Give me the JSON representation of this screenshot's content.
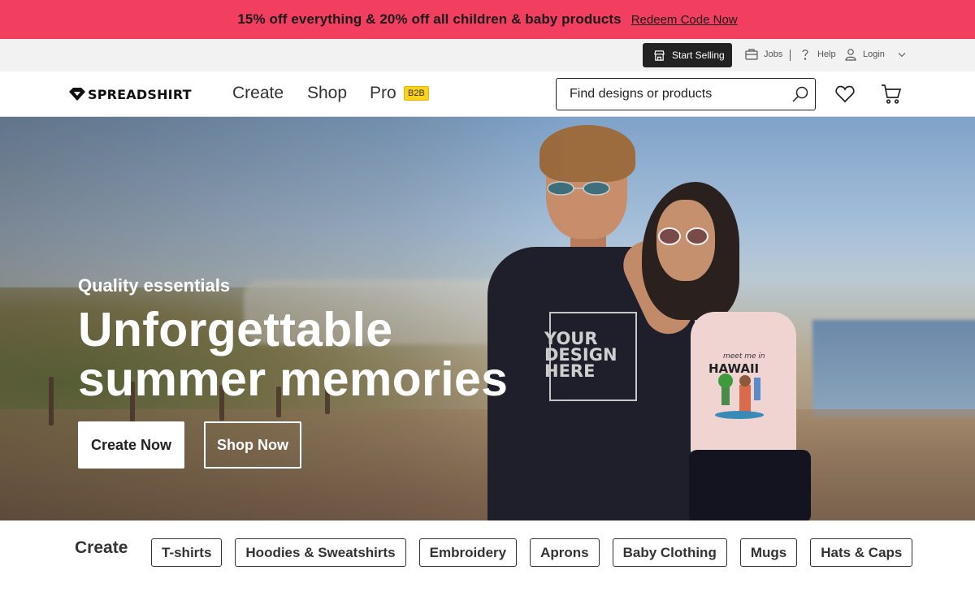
{
  "promo": {
    "text": "15% off everything & 20% off all children & baby products",
    "link": "Redeem Code Now"
  },
  "utility": {
    "start_selling": "Start Selling",
    "jobs": "Jobs",
    "help": "Help",
    "login": "Login"
  },
  "header": {
    "logo": "SPREADSHIRT",
    "nav": [
      "Create",
      "Shop",
      "Pro"
    ],
    "pro_badge": "B2B",
    "search_placeholder": "Find designs or products"
  },
  "hero": {
    "eyebrow": "Quality essentials",
    "title_line1": "Unforgettable",
    "title_line2": "summer memories",
    "shirt_design": [
      "YOUR",
      "DESIGN",
      "HERE"
    ],
    "tank_print": [
      "meet me in",
      "HAWAII"
    ],
    "primary_cta": "Create Now",
    "secondary_cta": "Shop Now"
  },
  "categories": {
    "label": "Create",
    "items": [
      "T-shirts",
      "Hoodies & Sweatshirts",
      "Embroidery",
      "Aprons",
      "Baby Clothing",
      "Mugs",
      "Hats & Caps"
    ]
  },
  "colors": {
    "promo_bg": "#f23e5f",
    "utility_bg": "#f2f2f2",
    "b2b_badge": "#ffd21f",
    "dark_button": "#222222"
  },
  "icons": [
    "store-icon",
    "briefcase-icon",
    "question-icon",
    "user-icon",
    "chevron-down-icon",
    "search-icon",
    "heart-icon",
    "cart-icon",
    "logo-mark-icon"
  ]
}
